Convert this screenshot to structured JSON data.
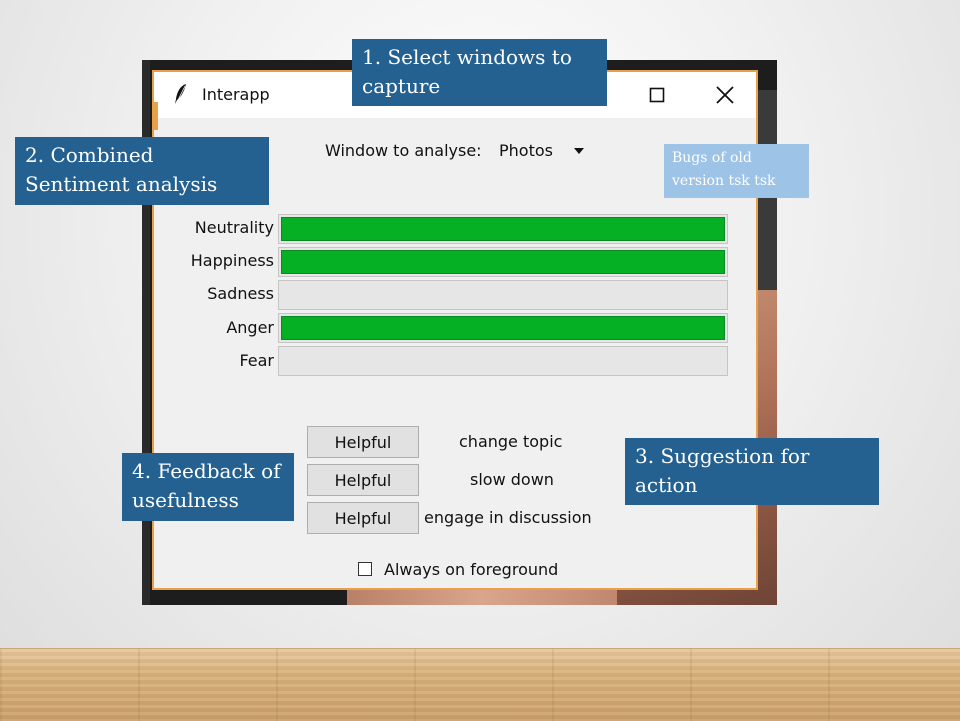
{
  "callouts": {
    "step1": "1. Select windows  to capture",
    "step2": "2. Combined Sentiment analysis",
    "step3": "3. Suggestion  for action",
    "step4": "4. Feedback of usefulness",
    "note": "Bugs of old version tsk tsk"
  },
  "window": {
    "title": "Interapp",
    "icons": {
      "app": "feather-icon",
      "maximize": "maximize-icon",
      "close": "close-icon"
    },
    "selector": {
      "label": "Window to analyse:",
      "value": "Photos",
      "icon": "chevron-down-icon"
    },
    "emotions": [
      {
        "label": "Neutrality",
        "value": 1.0
      },
      {
        "label": "Happiness",
        "value": 1.0
      },
      {
        "label": "Sadness",
        "value": 0.0
      },
      {
        "label": "Anger",
        "value": 1.0
      },
      {
        "label": "Fear",
        "value": 0.0
      }
    ],
    "bar_color": "#06b025",
    "suggestions": [
      {
        "button": "Helpful",
        "text": "change topic"
      },
      {
        "button": "Helpful",
        "text": "slow down"
      },
      {
        "button": "Helpful",
        "text": "engage in discussion"
      }
    ],
    "always_on_top": {
      "label": "Always on foreground",
      "checked": false
    }
  },
  "colors": {
    "callout": "#246190",
    "note": "#9dc3e6",
    "window_border": "#e8a04a"
  }
}
